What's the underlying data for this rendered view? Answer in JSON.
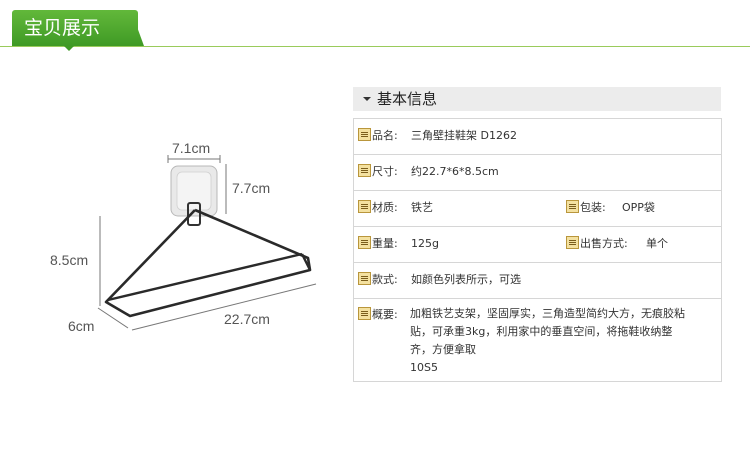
{
  "header": {
    "title": "宝贝展示"
  },
  "figure": {
    "dims": {
      "top_width": "7.1cm",
      "plate_height": "7.7cm",
      "height": "8.5cm",
      "depth": "6cm",
      "length": "22.7cm"
    }
  },
  "info": {
    "title": "基本信息",
    "rows": {
      "name": {
        "label": "品名:",
        "value": "三角壁挂鞋架 D1262"
      },
      "size": {
        "label": "尺寸:",
        "value": "约22.7*6*8.5cm"
      },
      "material": {
        "label": "材质:",
        "value": "铁艺"
      },
      "package": {
        "label": "包装:",
        "value": "OPP袋"
      },
      "weight": {
        "label": "重量:",
        "value": "125g"
      },
      "sale": {
        "label": "出售方式:",
        "value": "单个"
      },
      "style": {
        "label": "款式:",
        "value": "如颜色列表所示，可选"
      },
      "summary": {
        "label": "概要:",
        "line1": "加粗铁艺支架，坚固厚实，三角造型简约大方，无痕胶粘",
        "line2": "贴，可承重3kg，利用家中的垂直空间，将拖鞋收纳整",
        "line3": "齐，方便拿取",
        "line4": "10S5"
      }
    }
  },
  "colors": {
    "header_green": "#4aa52d",
    "header_line": "#9acb5b"
  },
  "icons": {
    "row_icon": "note-icon",
    "section_caret": "caret-down-icon"
  }
}
